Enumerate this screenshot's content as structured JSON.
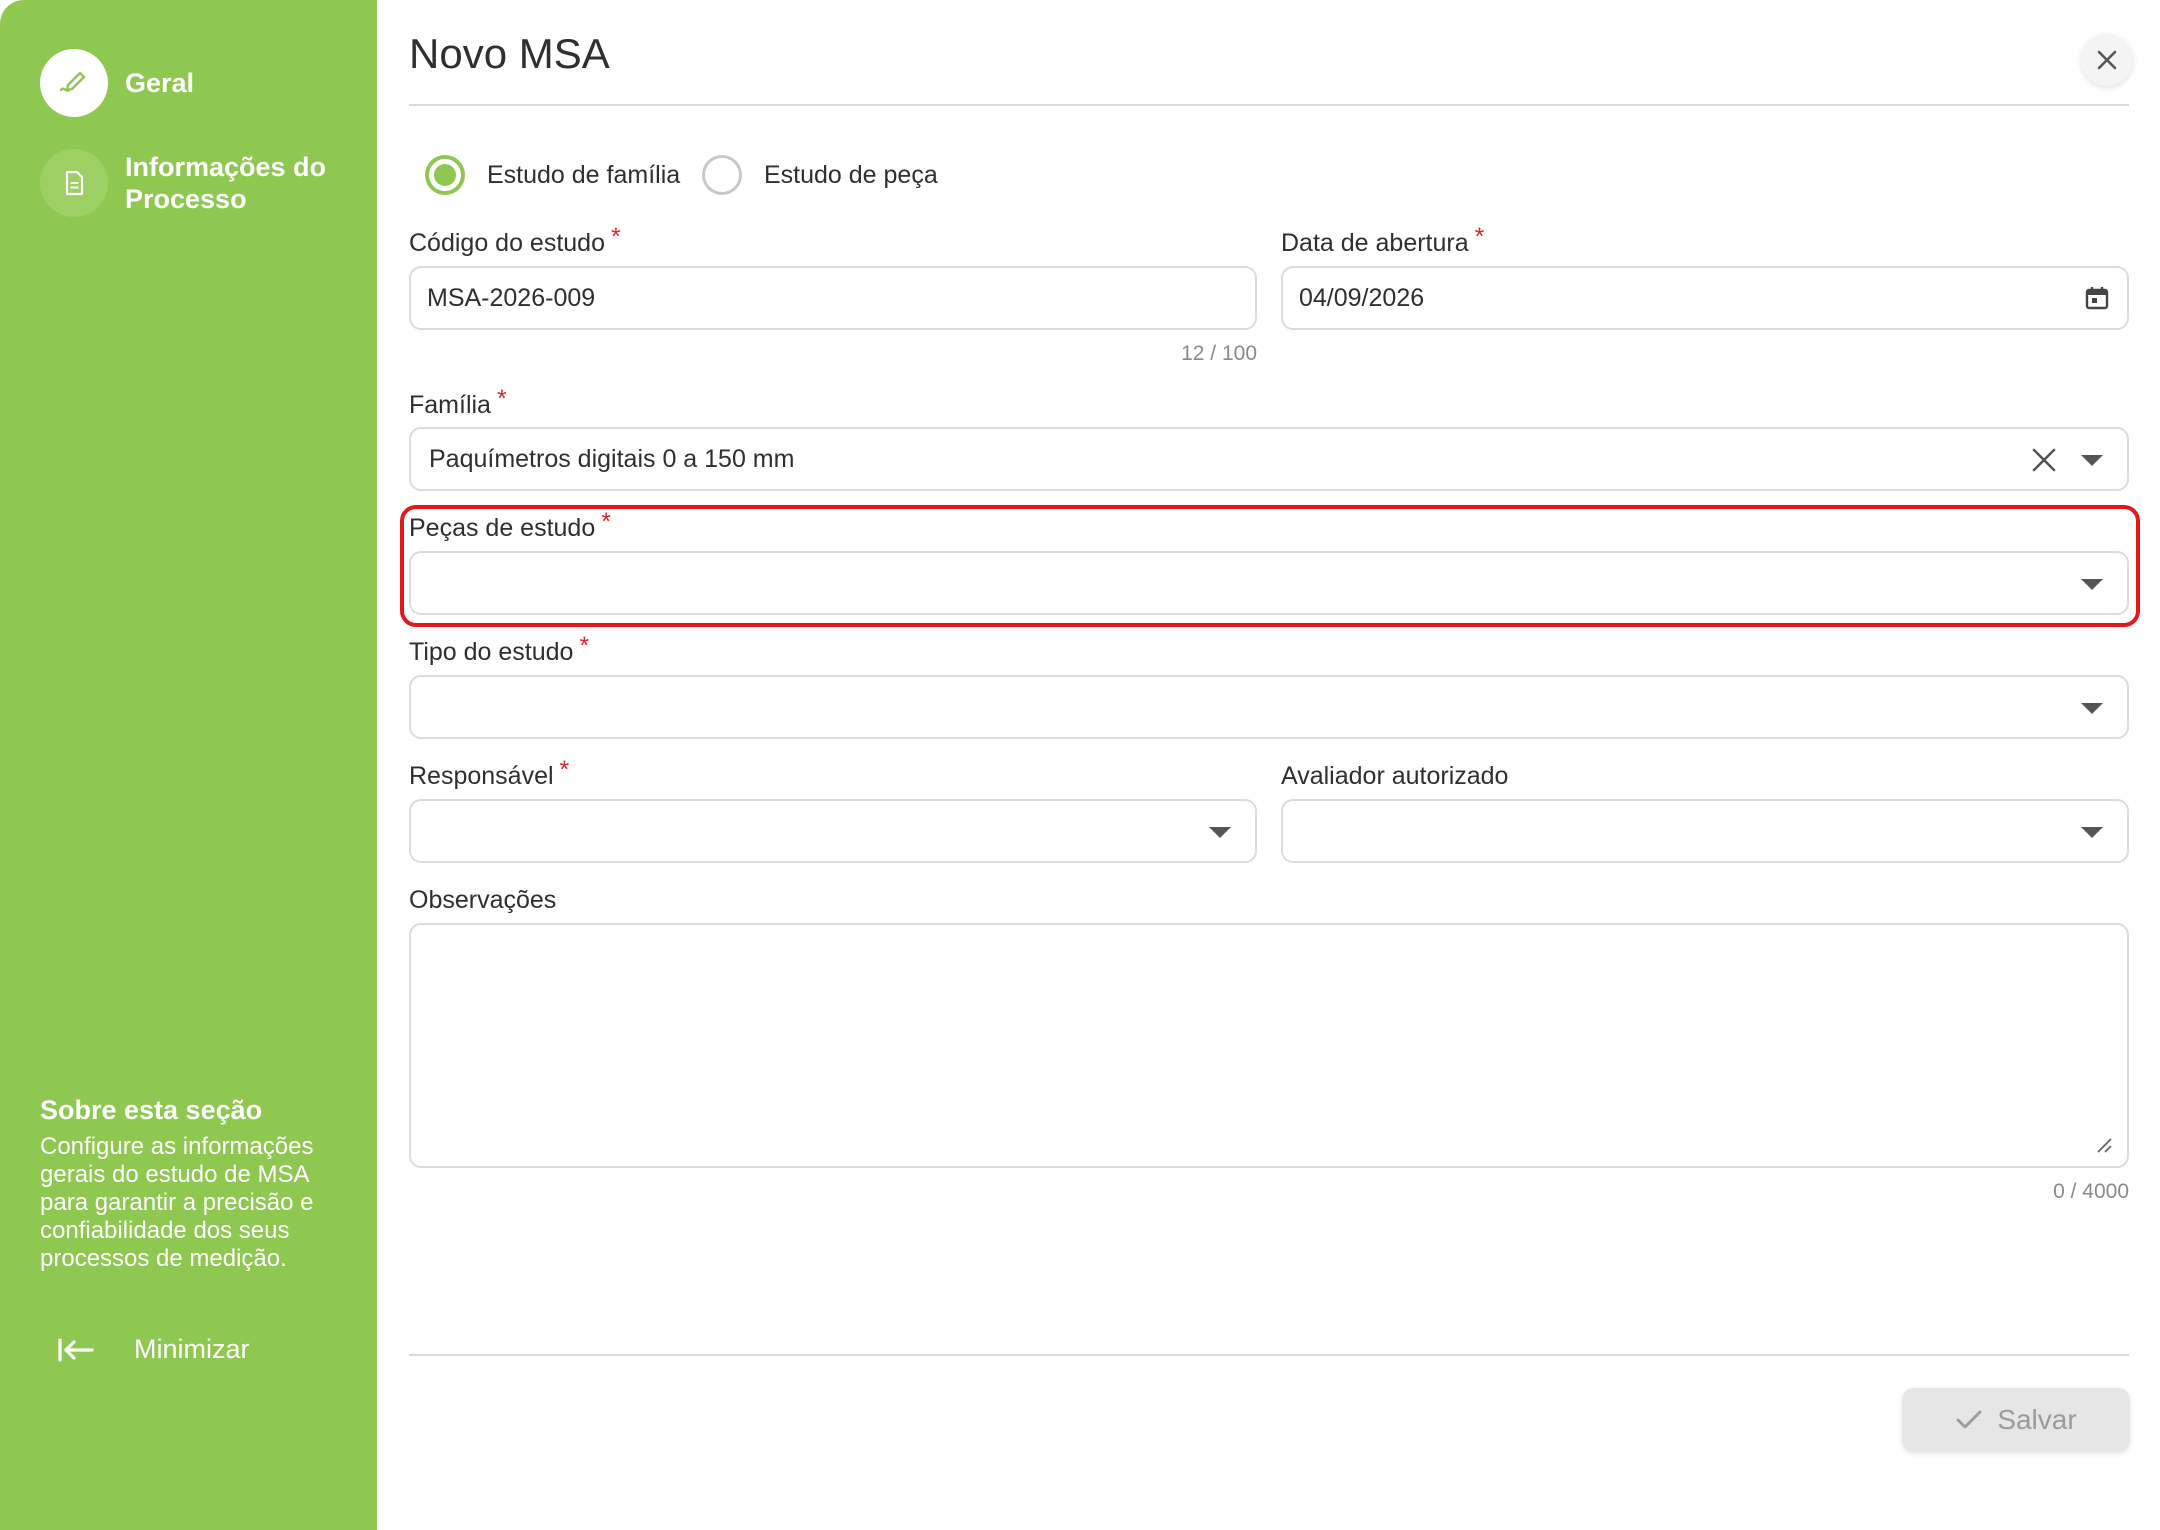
{
  "sidebar": {
    "items": [
      {
        "label": "Geral",
        "icon": "pencil-icon",
        "active": true
      },
      {
        "label": "Informações do Processo",
        "icon": "document-icon",
        "active": false
      }
    ],
    "about_title": "Sobre esta seção",
    "about_text": "Configure as informações gerais do estudo de MSA para garantir a precisão e confiabilidade dos seus processos de medição.",
    "minimize_label": "Minimizar"
  },
  "dialog": {
    "title": "Novo MSA",
    "study_type_options": [
      {
        "label": "Estudo de família",
        "checked": true
      },
      {
        "label": "Estudo de peça",
        "checked": false
      }
    ]
  },
  "form": {
    "codigo": {
      "label": "Código do estudo",
      "required": "*",
      "value": "MSA-2026-009",
      "counter": "12 / 100"
    },
    "data_abertura": {
      "label": "Data de abertura",
      "required": "*",
      "value": "04/09/2026"
    },
    "familia": {
      "label": "Família",
      "required": "*",
      "value": "Paquímetros digitais 0 a 150 mm"
    },
    "pecas": {
      "label": "Peças de estudo",
      "required": "*",
      "value": ""
    },
    "tipo": {
      "label": "Tipo do estudo",
      "required": "*",
      "value": ""
    },
    "responsavel": {
      "label": "Responsável",
      "required": "*",
      "value": ""
    },
    "avaliador": {
      "label": "Avaliador autorizado",
      "value": ""
    },
    "observacoes": {
      "label": "Observações",
      "value": "",
      "counter": "0 / 4000"
    }
  },
  "actions": {
    "save_label": "Salvar"
  },
  "colors": {
    "sidebar": "#8fc851",
    "required": "#e0262a",
    "highlight": "#e01a1a"
  }
}
